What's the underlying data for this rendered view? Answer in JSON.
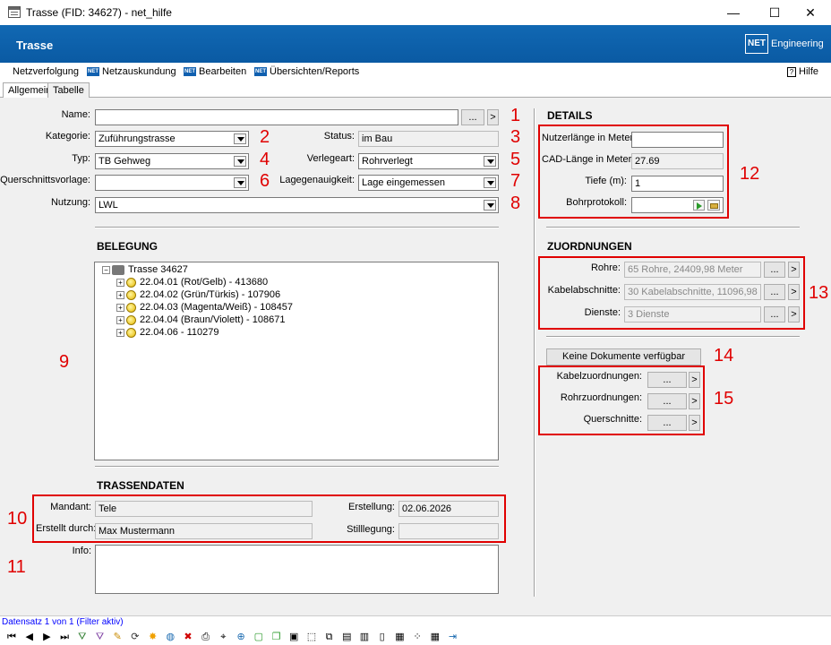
{
  "window": {
    "title": "Trasse (FID: 34627) - net_hilfe",
    "minimize": "—",
    "maximize": "☐",
    "close": "✕"
  },
  "header": {
    "title": "Trasse",
    "logo_net": "NET",
    "logo_text": "Engineering"
  },
  "menu": {
    "items": [
      "Netzverfolgung",
      "Netzauskundung",
      "Bearbeiten",
      "Übersichten/Reports"
    ],
    "net_icon": "NET",
    "help": "Hilfe",
    "help_icon": "?"
  },
  "tabs": [
    "Allgemein",
    "Tabelle"
  ],
  "form": {
    "name_label": "Name:",
    "name_value": "",
    "ellipsis": "...",
    "arrow": ">",
    "kategorie_label": "Kategorie:",
    "kategorie_value": "Zuführungstrasse",
    "status_label": "Status:",
    "status_value": "im Bau",
    "typ_label": "Typ:",
    "typ_value": "TB Gehweg",
    "verlegeart_label": "Verlegeart:",
    "verlegeart_value": "Rohrverlegt",
    "querschnitt_label": "Querschnittsvorlage:",
    "querschnitt_value": "",
    "lagegenauigkeit_label": "Lagegenauigkeit:",
    "lagegenauigkeit_value": "Lage eingemessen",
    "nutzung_label": "Nutzung:",
    "nutzung_value": "LWL"
  },
  "belegung": {
    "title": "BELEGUNG",
    "root": "Trasse 34627",
    "items": [
      "22.04.01 (Rot/Gelb) - 413680",
      "22.04.02 (Grün/Türkis) - 107906",
      "22.04.03 (Magenta/Weiß) - 108457",
      "22.04.04 (Braun/Violett) - 108671",
      "22.04.06 - 110279"
    ]
  },
  "trassendaten": {
    "title": "TRASSENDATEN",
    "mandant_label": "Mandant:",
    "mandant_value": "Tele",
    "erstellt_label": "Erstellt durch:",
    "erstellt_value": "Max Mustermann",
    "erstellung_label": "Erstellung:",
    "erstellung_value": "02.06.2026",
    "stilllegung_label": "Stilllegung:",
    "stilllegung_value": "",
    "info_label": "Info:",
    "info_value": ""
  },
  "details": {
    "title": "DETAILS",
    "nutzerlaenge_label": "Nutzerlänge in Meter:",
    "nutzerlaenge_value": "",
    "cadlaenge_label": "CAD-Länge in Meter:",
    "cadlaenge_value": "27.69",
    "tiefe_label": "Tiefe (m):",
    "tiefe_value": "1",
    "bohrprotokoll_label": "Bohrprotokoll:"
  },
  "zuordnungen": {
    "title": "ZUORDNUNGEN",
    "rohre_label": "Rohre:",
    "rohre_value": "65 Rohre, 24409,98 Meter",
    "kabel_label": "Kabelabschnitte:",
    "kabel_value": "30 Kabelabschnitte, 11096,98 Meter",
    "dienste_label": "Dienste:",
    "dienste_value": "3 Dienste"
  },
  "dokumente": {
    "button": "Keine Dokumente verfügbar",
    "kabelzuordnungen_label": "Kabelzuordnungen:",
    "rohrzuordnungen_label": "Rohrzuordnungen:",
    "querschnitte_label": "Querschnitte:"
  },
  "annotations": [
    "1",
    "2",
    "3",
    "4",
    "5",
    "6",
    "7",
    "8",
    "9",
    "10",
    "11",
    "12",
    "13",
    "14",
    "15"
  ],
  "annotation_color": "#e00000",
  "status": {
    "record": "Datensatz 1 von 1 (Filter aktiv)"
  },
  "toolbar_icons": [
    "first-icon",
    "prev-icon",
    "next-icon",
    "last-icon",
    "filter-add-icon",
    "filter-icon",
    "pencil-icon",
    "refresh-icon",
    "star-icon",
    "globe-icon",
    "delete-icon",
    "print-icon",
    "select-icon",
    "zoom-icon",
    "shape-icon",
    "copy-icon",
    "layers-icon",
    "frame-icon",
    "duplicate-icon",
    "new-doc-icon",
    "page-icon",
    "document-icon",
    "image-icon",
    "scatter-icon",
    "table-icon",
    "exit-icon"
  ]
}
